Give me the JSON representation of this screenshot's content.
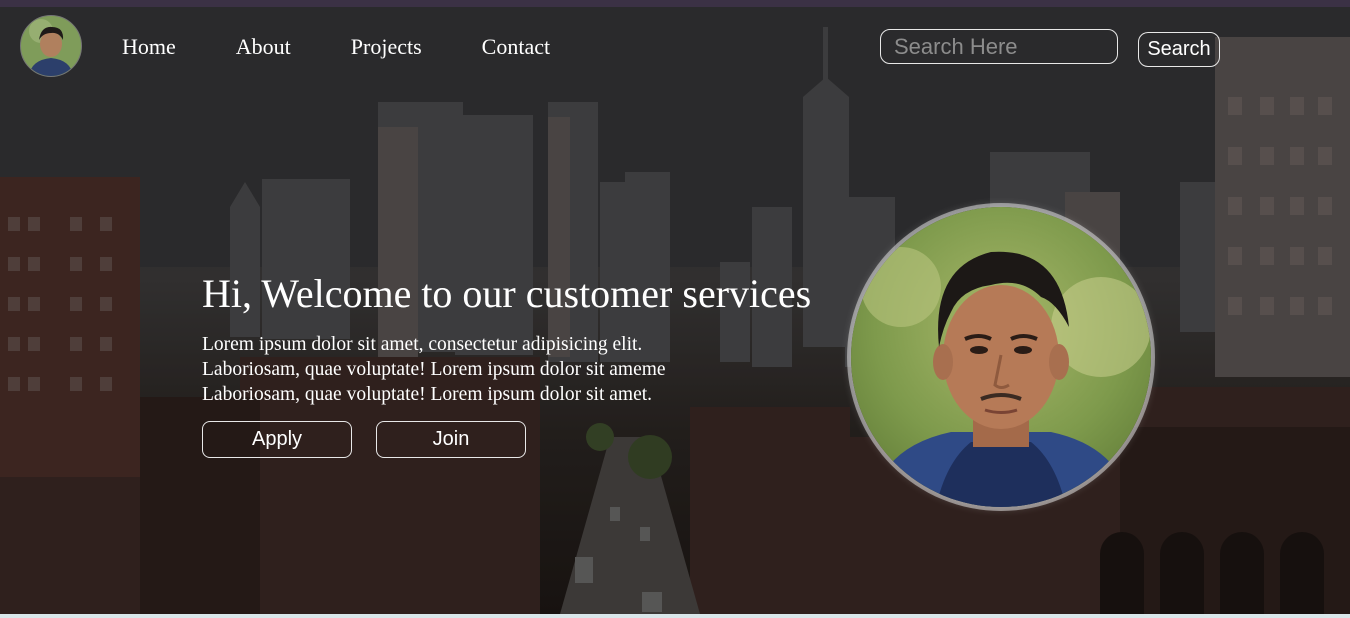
{
  "nav": {
    "links": [
      "Home",
      "About",
      "Projects",
      "Contact"
    ]
  },
  "search": {
    "placeholder": "Search Here",
    "button_label": "Search"
  },
  "hero": {
    "title": "Hi, Welcome to our customer services",
    "paragraph_lines": [
      "Lorem ipsum dolor sit amet, consectetur adipisicing elit.",
      "Laboriosam, quae voluptate! Lorem ipsum dolor sit ameme",
      "Laboriosam, quae voluptate! Lorem ipsum dolor sit amet."
    ],
    "apply_label": "Apply",
    "join_label": "Join"
  },
  "colors": {
    "top_strip": "#3b3145",
    "text": "#ffffff",
    "placeholder": "#8c8c8c"
  }
}
